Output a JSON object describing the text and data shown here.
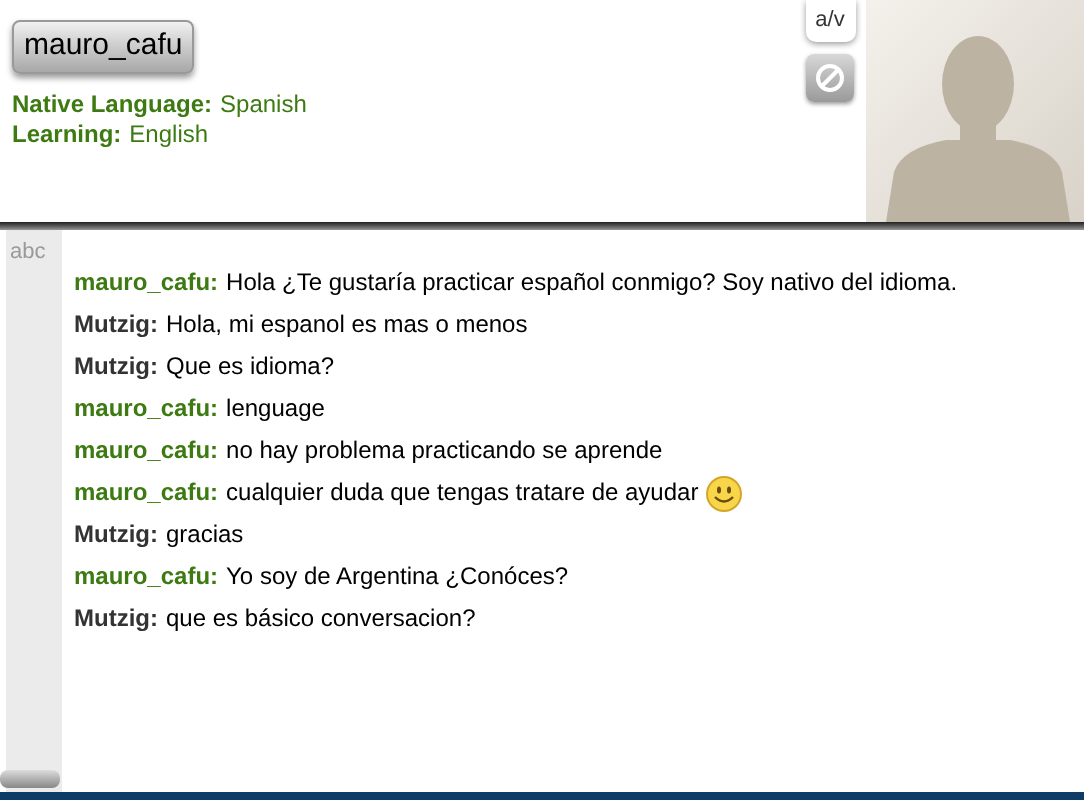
{
  "profile": {
    "username": "mauro_cafu",
    "details": [
      {
        "label": "Native Language:",
        "value": "Spanish"
      },
      {
        "label": "Learning:",
        "value": "English"
      }
    ]
  },
  "buttons": {
    "av": "a/v"
  },
  "spellcheck": "abc",
  "messages": [
    {
      "kind": "partner",
      "sender": "mauro_cafu:",
      "text": "Hola ¿Te gustaría practicar español conmigo? Soy nativo del idioma.",
      "emoji": false
    },
    {
      "kind": "self",
      "sender": "Mutzig:",
      "text": "Hola, mi espanol es mas o menos",
      "emoji": false
    },
    {
      "kind": "self",
      "sender": "Mutzig:",
      "text": "Que es idioma?",
      "emoji": false
    },
    {
      "kind": "partner",
      "sender": "mauro_cafu:",
      "text": "lenguage",
      "emoji": false
    },
    {
      "kind": "partner",
      "sender": "mauro_cafu:",
      "text": "no hay problema practicando se aprende",
      "emoji": false
    },
    {
      "kind": "partner",
      "sender": "mauro_cafu:",
      "text": "cualquier duda que tengas tratare de ayudar",
      "emoji": true
    },
    {
      "kind": "self",
      "sender": "Mutzig:",
      "text": "gracias",
      "emoji": false
    },
    {
      "kind": "partner",
      "sender": "mauro_cafu:",
      "text": "Yo soy de Argentina ¿Conóces?",
      "emoji": false
    },
    {
      "kind": "self",
      "sender": "Mutzig:",
      "text": "que es básico conversacion?",
      "emoji": false
    }
  ]
}
